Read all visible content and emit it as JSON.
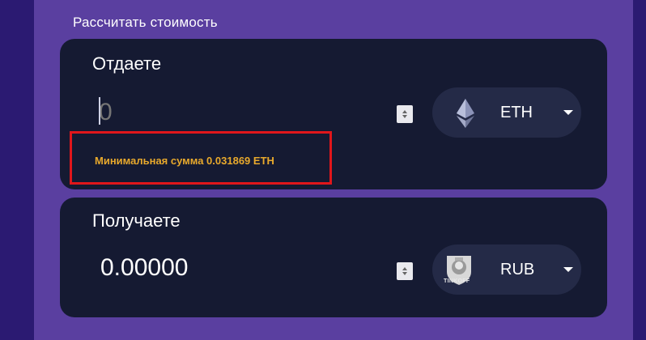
{
  "header": {
    "title": "Рассчитать стоимость"
  },
  "give": {
    "label": "Отдаете",
    "amount_placeholder": "0",
    "amount_value": "",
    "min_hint": "Минимальная сумма 0.031869 ETH",
    "currency": {
      "code": "ETH",
      "icon": "ethereum-icon"
    }
  },
  "get": {
    "label": "Получаете",
    "amount_value": "0.00000",
    "currency": {
      "code": "RUB",
      "icon": "tinkoff-logo",
      "logo_text": "TINKOFF"
    }
  },
  "colors": {
    "page_background": "#2a1a6e",
    "panel_background": "#5a3fa0",
    "card_background": "#151a32",
    "currency_pill": "#242a47",
    "hint_text": "#e8a92c",
    "highlight_border": "#e0161b"
  }
}
